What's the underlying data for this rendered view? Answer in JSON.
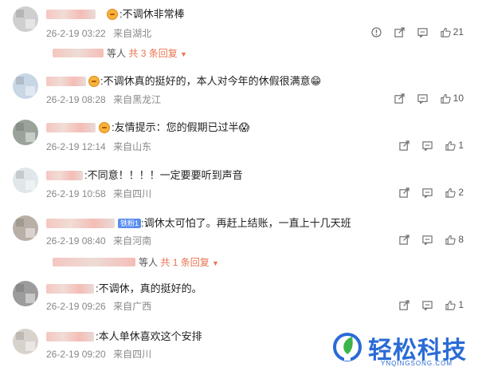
{
  "comments": [
    {
      "text": ":不调休非常棒",
      "date": "26-2-19 03:22",
      "location": "来自湖北",
      "likes": "21",
      "replies": {
        "suffix": "等人",
        "link": "共 3 条回复"
      }
    },
    {
      "text": ":不调休真的挺好的，本人对今年的休假很满意😁",
      "date": "26-2-19 08:28",
      "location": "来自黑龙江",
      "likes": "10"
    },
    {
      "text": ":友情提示：您的假期已过半😱",
      "date": "26-2-19 12:14",
      "location": "来自山东",
      "likes": "1"
    },
    {
      "text": ":不同意！！！！一定要要听到声音",
      "date": "26-2-19 10:58",
      "location": "来自四川",
      "likes": "2"
    },
    {
      "badge": "铁粉1",
      "text": ":调休太可怕了。再赶上结账，一直上十几天班",
      "date": "26-2-19 08:40",
      "location": "来自河南",
      "likes": "8",
      "replies": {
        "suffix": "等人",
        "link": "共 1 条回复"
      }
    },
    {
      "text": ":不调休，真的挺好的。",
      "date": "26-2-19 09:26",
      "location": "来自广西",
      "likes": "1"
    },
    {
      "text": ":本人单休喜欢这个安排",
      "date": "26-2-19 09:20",
      "location": "来自四川",
      "likes": ""
    }
  ],
  "watermark": {
    "title": "轻松科技",
    "subtitle": "YNQINGSONG.COM"
  },
  "colors": {
    "accent": "#eb7350",
    "brand": "#2a6bd6"
  }
}
